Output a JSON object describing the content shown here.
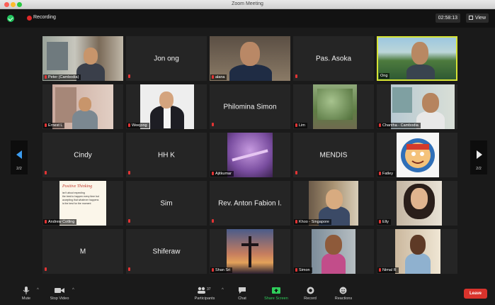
{
  "window": {
    "title": "Zoom Meeting"
  },
  "topbar": {
    "recording_label": "Recording",
    "timer": "02:58:13",
    "view_label": "View"
  },
  "pagination": {
    "left": "2/2",
    "right": "2/2"
  },
  "participants": [
    {
      "name": "Peter (Cambodia)",
      "video": true
    },
    {
      "name": "Jon ong",
      "video": false
    },
    {
      "name": "alana",
      "video": true
    },
    {
      "name": "Pas. Asoka",
      "video": false
    },
    {
      "name": "Ong",
      "video": true
    },
    {
      "name": "Ernest L",
      "video": true
    },
    {
      "name": "Weejong",
      "video": true
    },
    {
      "name": "Philomina Simon",
      "video": false
    },
    {
      "name": "Lim",
      "video": true
    },
    {
      "name": "Chantha - Cambodia",
      "video": true
    },
    {
      "name": "Cindy",
      "video": false
    },
    {
      "name": "HH K",
      "video": false
    },
    {
      "name": "Ajitkumar",
      "video": true
    },
    {
      "name": "MENDIS",
      "video": false
    },
    {
      "name": "Fatley",
      "video": true
    },
    {
      "name": "Andrew Cotling",
      "video": true
    },
    {
      "name": "Sim",
      "video": false
    },
    {
      "name": "Rev. Anton Fabion I.",
      "video": false
    },
    {
      "name": "Khoo - Singapore",
      "video": true
    },
    {
      "name": "Elly",
      "video": true
    },
    {
      "name": "M",
      "video": false
    },
    {
      "name": "Shiferaw",
      "video": false
    },
    {
      "name": "Shan Sri",
      "video": true
    },
    {
      "name": "Simon",
      "video": true
    },
    {
      "name": "Nimal R",
      "video": true
    }
  ],
  "quote_image": {
    "title": "Positive Thinking",
    "lines": [
      "isn't about expecting",
      "the best to happen every time but",
      "accepting that whatever happens",
      "is the best for the moment"
    ]
  },
  "toolbar": {
    "mute": "Mute",
    "stop_video": "Stop Video",
    "participants": "Participants",
    "participants_count": "37",
    "chat": "Chat",
    "share_screen": "Share Screen",
    "record": "Record",
    "reactions": "Reactions",
    "leave": "Leave"
  },
  "colors": {
    "active_speaker": "#d6e335",
    "share_green": "#2fce5b",
    "leave_red": "#d9332c",
    "recording_red": "#e02828"
  }
}
